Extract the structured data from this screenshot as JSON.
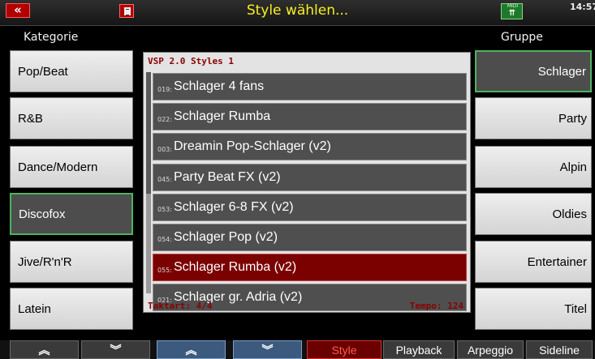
{
  "header": {
    "back_icon": "double-chevron-left-icon",
    "title": "Style wählen...",
    "midi_label": "MIDI",
    "time": "14:57"
  },
  "left_column": {
    "label": "Kategorie",
    "items": [
      {
        "label": "Pop/Beat",
        "active": false
      },
      {
        "label": "R&B",
        "active": false
      },
      {
        "label": "Dance/Modern",
        "active": false
      },
      {
        "label": "Discofox",
        "active": true
      },
      {
        "label": "Jive/R'n'R",
        "active": false
      },
      {
        "label": "Latein",
        "active": false
      }
    ]
  },
  "right_column": {
    "label": "Gruppe",
    "items": [
      {
        "label": "Schlager",
        "active": true
      },
      {
        "label": "Party",
        "active": false
      },
      {
        "label": "Alpin",
        "active": false
      },
      {
        "label": "Oldies",
        "active": false
      },
      {
        "label": "Entertainer",
        "active": false
      },
      {
        "label": "Titel",
        "active": false
      }
    ]
  },
  "center": {
    "bank_title": "VSP 2.0 Styles 1",
    "styles": [
      {
        "num": "019:",
        "name": "Schlager 4 fans",
        "selected": false
      },
      {
        "num": "022:",
        "name": "Schlager Rumba",
        "selected": false
      },
      {
        "num": "003:",
        "name": "Dreamin Pop-Schlager (v2)",
        "selected": false
      },
      {
        "num": "045:",
        "name": "Party Beat FX (v2)",
        "selected": false
      },
      {
        "num": "053:",
        "name": "Schlager 6-8 FX (v2)",
        "selected": false
      },
      {
        "num": "054:",
        "name": "Schlager Pop (v2)",
        "selected": false
      },
      {
        "num": "055:",
        "name": "Schlager Rumba (v2)",
        "selected": true
      },
      {
        "num": "021:",
        "name": "Schlager gr. Adria (v2)",
        "selected": false
      }
    ],
    "taktart": "Taktart: 4/4",
    "tempo": "Tempo: 124"
  },
  "bottom": {
    "up_glyph": "≈",
    "down_glyph": "≈",
    "style_label": "Style",
    "playback_label": "Playback",
    "arpeggio_label": "Arpeggio",
    "sideline_label": "Sideline"
  }
}
